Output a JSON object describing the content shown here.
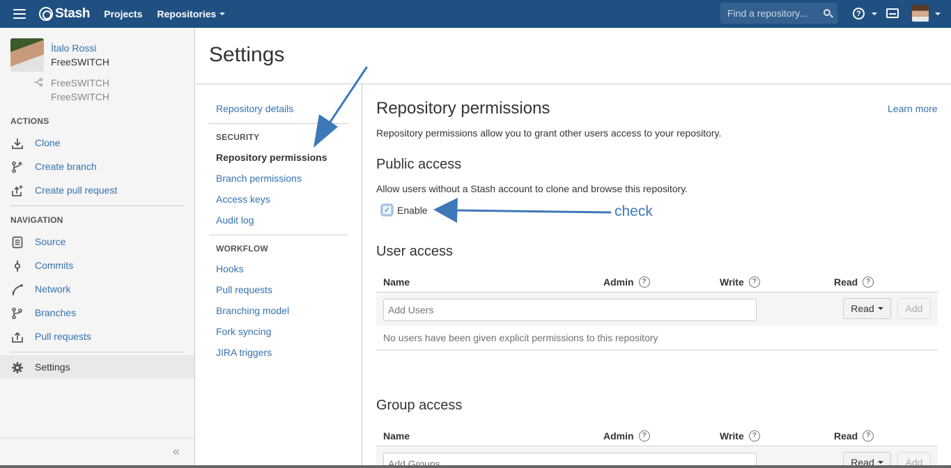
{
  "topbar": {
    "brand": "Stash",
    "nav": [
      "Projects",
      "Repositories"
    ],
    "search_placeholder": "Find a repository...",
    "help_glyph": "?"
  },
  "sidebar": {
    "user_name": "Ítalo Rossi",
    "project": "FreeSWITCH",
    "fork_project": "FreeSWITCH",
    "fork_repo": "FreeSWITCH",
    "actions_heading": "ACTIONS",
    "actions": [
      {
        "label": "Clone",
        "icon": "download-icon"
      },
      {
        "label": "Create branch",
        "icon": "branch-add-icon"
      },
      {
        "label": "Create pull request",
        "icon": "pull-request-add-icon"
      }
    ],
    "navigation_heading": "NAVIGATION",
    "navigation": [
      {
        "label": "Source",
        "icon": "document-icon"
      },
      {
        "label": "Commits",
        "icon": "commit-icon"
      },
      {
        "label": "Network",
        "icon": "network-icon"
      },
      {
        "label": "Branches",
        "icon": "branch-icon"
      },
      {
        "label": "Pull requests",
        "icon": "pull-request-icon"
      }
    ],
    "settings": {
      "label": "Settings",
      "icon": "gear-icon"
    },
    "collapse_glyph": "«"
  },
  "page": {
    "title": "Settings"
  },
  "settings_nav": {
    "repository_details": "Repository details",
    "security_heading": "SECURITY",
    "security": [
      "Repository permissions",
      "Branch permissions",
      "Access keys",
      "Audit log"
    ],
    "workflow_heading": "WORKFLOW",
    "workflow": [
      "Hooks",
      "Pull requests",
      "Branching model",
      "Fork syncing",
      "JIRA triggers"
    ]
  },
  "main": {
    "title": "Repository permissions",
    "learn_more": "Learn more",
    "description": "Repository permissions allow you to grant other users access to your repository.",
    "public_access": {
      "title": "Public access",
      "description": "Allow users without a Stash account to clone and browse this repository.",
      "checkbox_label": "Enable",
      "checked": true
    },
    "annotation": "check",
    "user_access": {
      "title": "User access",
      "columns": [
        "Name",
        "Admin",
        "Write",
        "Read"
      ],
      "input_placeholder": "Add Users",
      "permission_select": "Read",
      "add_button": "Add",
      "empty_message": "No users have been given explicit permissions to this repository"
    },
    "group_access": {
      "title": "Group access",
      "columns": [
        "Name",
        "Admin",
        "Write",
        "Read"
      ],
      "input_placeholder": "Add Groups",
      "permission_select": "Read",
      "add_button": "Add"
    }
  },
  "colors": {
    "header": "#205081",
    "link": "#3572b0",
    "annotation": "#3d78b9"
  }
}
